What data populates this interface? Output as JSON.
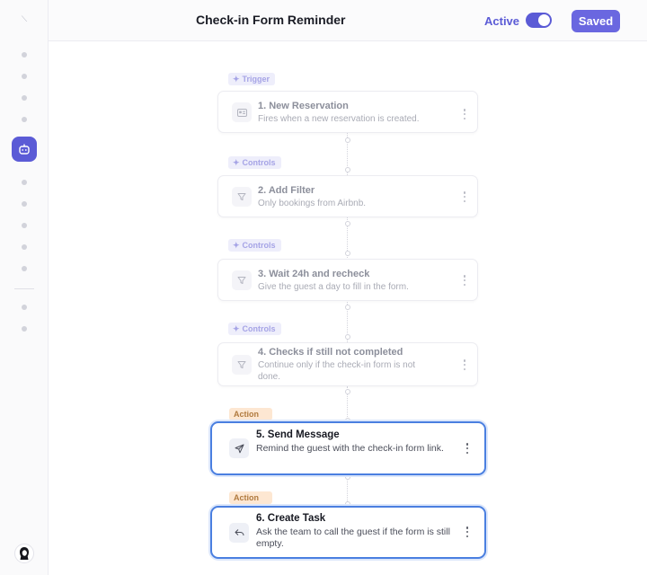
{
  "header": {
    "title": "Check-in Form Reminder",
    "status_label": "Active",
    "status_on": true,
    "saved_label": "Saved"
  },
  "colors": {
    "accent": "#5b5bd6",
    "active_border": "#4a7fe0",
    "action_tag_bg": "#fde7d2",
    "controls_tag_bg": "#eeeefb"
  },
  "sidebar": {
    "active_icon": "bot-icon",
    "avatar_icon": "user-avatar-icon"
  },
  "flow": {
    "steps": [
      {
        "tag": "Trigger",
        "tag_icon": "sparkle-icon",
        "title": "1. New Reservation",
        "desc": "Fires when a new reservation is created.",
        "icon": "id-card-icon"
      },
      {
        "tag": "Controls",
        "tag_icon": "sparkle-icon",
        "title": "2. Add Filter",
        "desc": "Only bookings from Airbnb.",
        "icon": "filter-icon"
      },
      {
        "tag": "Controls",
        "tag_icon": "sparkle-icon",
        "title": "3. Wait 24h and recheck",
        "desc": "Give the guest a day to fill in the form.",
        "icon": "filter-icon"
      },
      {
        "tag": "Controls",
        "tag_icon": "sparkle-icon",
        "title": "4. Checks if still not completed",
        "desc": "Continue only if the check-in form is not done.",
        "icon": "filter-icon"
      },
      {
        "tag": "Action",
        "title": "5. Send Message",
        "desc": "Remind the guest with the check-in form link.",
        "icon": "send-icon"
      },
      {
        "tag": "Action",
        "title": "6. Create Task",
        "desc": "Ask the team to call the guest if the form is still empty.",
        "icon": "reply-icon"
      }
    ]
  }
}
